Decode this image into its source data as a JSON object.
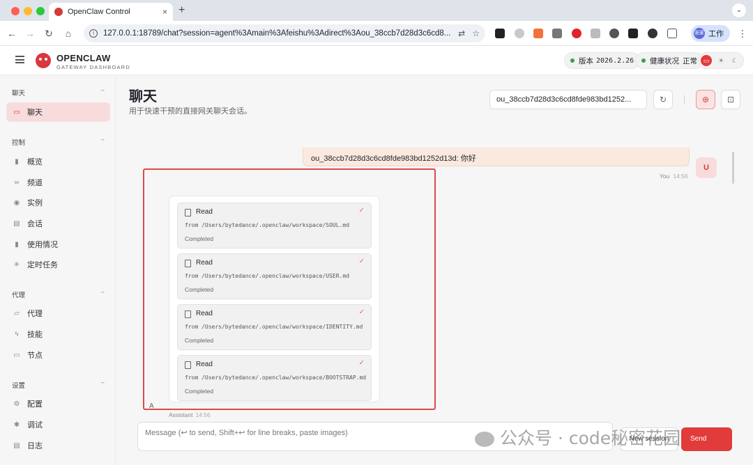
{
  "browser": {
    "tab_title": "OpenClaw Control",
    "url": "127.0.0.1:18789/chat?session=agent%3Amain%3Afeishu%3Adirect%3Aou_38ccb7d28d3c6cd8...",
    "profile_name": "工作",
    "profile_initials": "张家",
    "new_tab_glyph": "+",
    "close_tab_glyph": "×"
  },
  "app": {
    "brand": "OPENCLAW",
    "brand_sub": "GATEWAY DASHBOARD",
    "version_label": "版本",
    "version_value": "2026.2.26",
    "health_label": "健康状况",
    "health_value": "正常"
  },
  "sidebar": {
    "sections": [
      {
        "title": "聊天",
        "items": [
          {
            "label": "聊天",
            "icon": "chat-icon",
            "active": true
          }
        ]
      },
      {
        "title": "控制",
        "items": [
          {
            "label": "概览",
            "icon": "bar-chart-icon"
          },
          {
            "label": "频道",
            "icon": "link-icon"
          },
          {
            "label": "实例",
            "icon": "radio-icon"
          },
          {
            "label": "会话",
            "icon": "document-icon"
          },
          {
            "label": "使用情况",
            "icon": "bar-chart-icon"
          },
          {
            "label": "定时任务",
            "icon": "loader-icon"
          }
        ]
      },
      {
        "title": "代理",
        "items": [
          {
            "label": "代理",
            "icon": "folder-icon"
          },
          {
            "label": "技能",
            "icon": "bolt-icon"
          },
          {
            "label": "节点",
            "icon": "monitor-icon"
          }
        ]
      },
      {
        "title": "设置",
        "items": [
          {
            "label": "配置",
            "icon": "gear-icon"
          },
          {
            "label": "调试",
            "icon": "bug-icon"
          },
          {
            "label": "日志",
            "icon": "file-icon"
          }
        ]
      }
    ]
  },
  "main": {
    "title": "聊天",
    "subtitle": "用于快速干预的直接网关聊天会话。",
    "session_select": "ou_38ccb7d28d3c6cd8fde983bd1252...",
    "user_message": "ou_38ccb7d28d3c6cd8fde983bd1252d13d: 你好",
    "user_sender": "You",
    "user_time": "14:56",
    "user_avatar": "U",
    "tool_calls": [
      {
        "name": "Read",
        "path": "from /Users/bytedance/.openclaw/workspace/SOUL.md",
        "status": "Completed"
      },
      {
        "name": "Read",
        "path": "from /Users/bytedance/.openclaw/workspace/USER.md",
        "status": "Completed"
      },
      {
        "name": "Read",
        "path": "from /Users/bytedance/.openclaw/workspace/IDENTITY.md",
        "status": "Completed"
      },
      {
        "name": "Read",
        "path": "from /Users/bytedance/.openclaw/workspace/BOOTSTRAP.md",
        "status": "Completed"
      }
    ],
    "assistant_avatar": "A",
    "assistant_sender": "Assistant",
    "assistant_time": "14:56",
    "composer_placeholder": "Message (↩ to send, Shift+↩ for line breaks, paste images)",
    "new_session_label": "New session",
    "send_label": "Send"
  },
  "watermark": "公众号 · code秘密花园",
  "colors": {
    "accent": "#d33b3b",
    "send": "#e23b3b",
    "active_nav_bg": "#f8dcdc",
    "highlight_border": "#e04848",
    "status_ok": "#2ea44f"
  }
}
